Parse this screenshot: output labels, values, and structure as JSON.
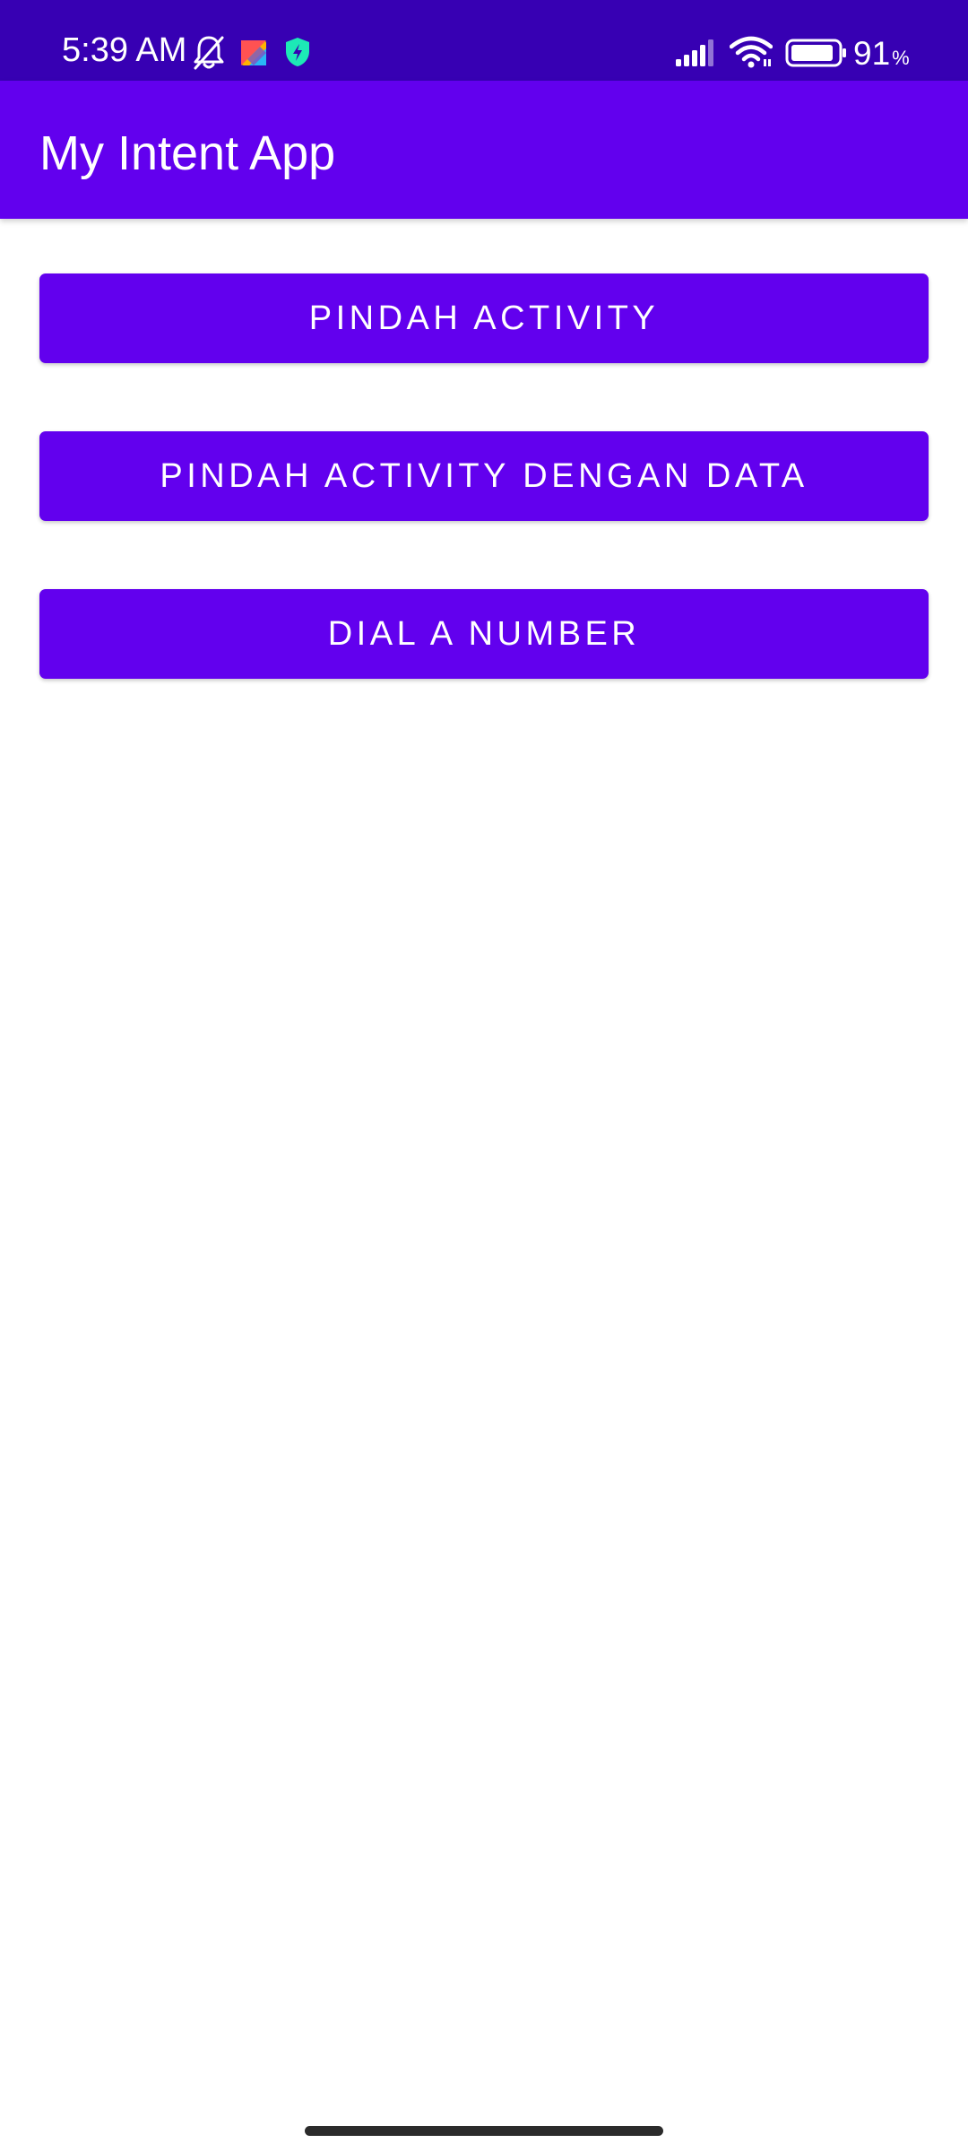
{
  "status_bar": {
    "time": "5:39 AM",
    "battery_value": "91",
    "battery_unit": "%",
    "icons": {
      "notifications_muted": "bell-off-icon",
      "app_notification": "kite-app-icon",
      "security": "shield-icon",
      "signal": "signal-icon",
      "wifi": "wifi-icon",
      "battery": "battery-icon"
    },
    "background_color": "#3700B3"
  },
  "app_bar": {
    "title": "My Intent App",
    "background_color": "#6200EE"
  },
  "buttons": [
    {
      "label": "PINDAH ACTIVITY"
    },
    {
      "label": "PINDAH ACTIVITY DENGAN DATA"
    },
    {
      "label": "DIAL A NUMBER"
    }
  ],
  "colors": {
    "primary": "#6200EE",
    "primary_dark": "#3700B3",
    "on_primary": "#FFFFFF",
    "background": "#FFFFFF"
  }
}
